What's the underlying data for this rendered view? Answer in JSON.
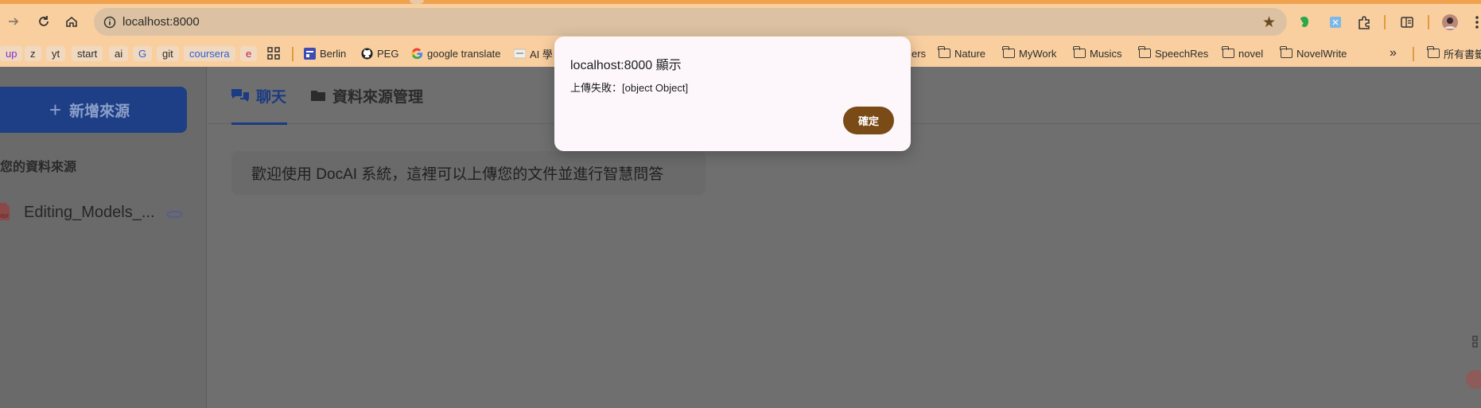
{
  "browser": {
    "url": "localhost:8000",
    "bookmarks": [
      {
        "label": "up",
        "type": "chip",
        "color": "#7b34c9"
      },
      {
        "label": "z",
        "type": "chip"
      },
      {
        "label": "yt",
        "type": "chip"
      },
      {
        "label": "start",
        "type": "chip"
      },
      {
        "label": "ai",
        "type": "chip"
      },
      {
        "label": "G",
        "type": "chip",
        "color": "#2b5fd9"
      },
      {
        "label": "git",
        "type": "chip"
      },
      {
        "label": "coursera",
        "type": "chip",
        "color": "#2b5fd9"
      },
      {
        "label": "e",
        "type": "chip",
        "color": "#c2185b"
      },
      {
        "label": "",
        "type": "grid-icon"
      },
      {
        "label": "Berlin",
        "type": "site"
      },
      {
        "label": "PEG",
        "type": "site"
      },
      {
        "label": "google translate",
        "type": "site"
      },
      {
        "label": "AI 學",
        "type": "site"
      },
      {
        "label": "ers",
        "type": "site"
      },
      {
        "label": "Nature",
        "type": "folder"
      },
      {
        "label": "MyWork",
        "type": "folder"
      },
      {
        "label": "Musics",
        "type": "folder"
      },
      {
        "label": "SpeechRes",
        "type": "folder"
      },
      {
        "label": "novel",
        "type": "folder"
      },
      {
        "label": "NovelWrite",
        "type": "folder"
      },
      {
        "label": "所有書籤",
        "type": "folder"
      }
    ],
    "more_label": "»"
  },
  "sidebar": {
    "add_source_label": "新增來源",
    "sources_title": "您的資料來源",
    "sources": [
      {
        "name": "Editing_Models_...",
        "icon": "pdf-icon",
        "status": "loading"
      }
    ]
  },
  "tabs": [
    {
      "label": "聊天",
      "icon": "chat-icon",
      "active": true
    },
    {
      "label": "資料來源管理",
      "icon": "folder-icon",
      "active": false
    }
  ],
  "chat": {
    "welcome_message": "歡迎使用 DocAI 系統，這裡可以上傳您的文件並進行智慧問答"
  },
  "dialog": {
    "title": "localhost:8000 顯示",
    "message": "上傳失敗：[object Object]",
    "ok_label": "確定"
  },
  "colors": {
    "primary": "#1b3b82",
    "dialog_button": "#7a4a17",
    "browser_frame": "#f9cfa0"
  }
}
